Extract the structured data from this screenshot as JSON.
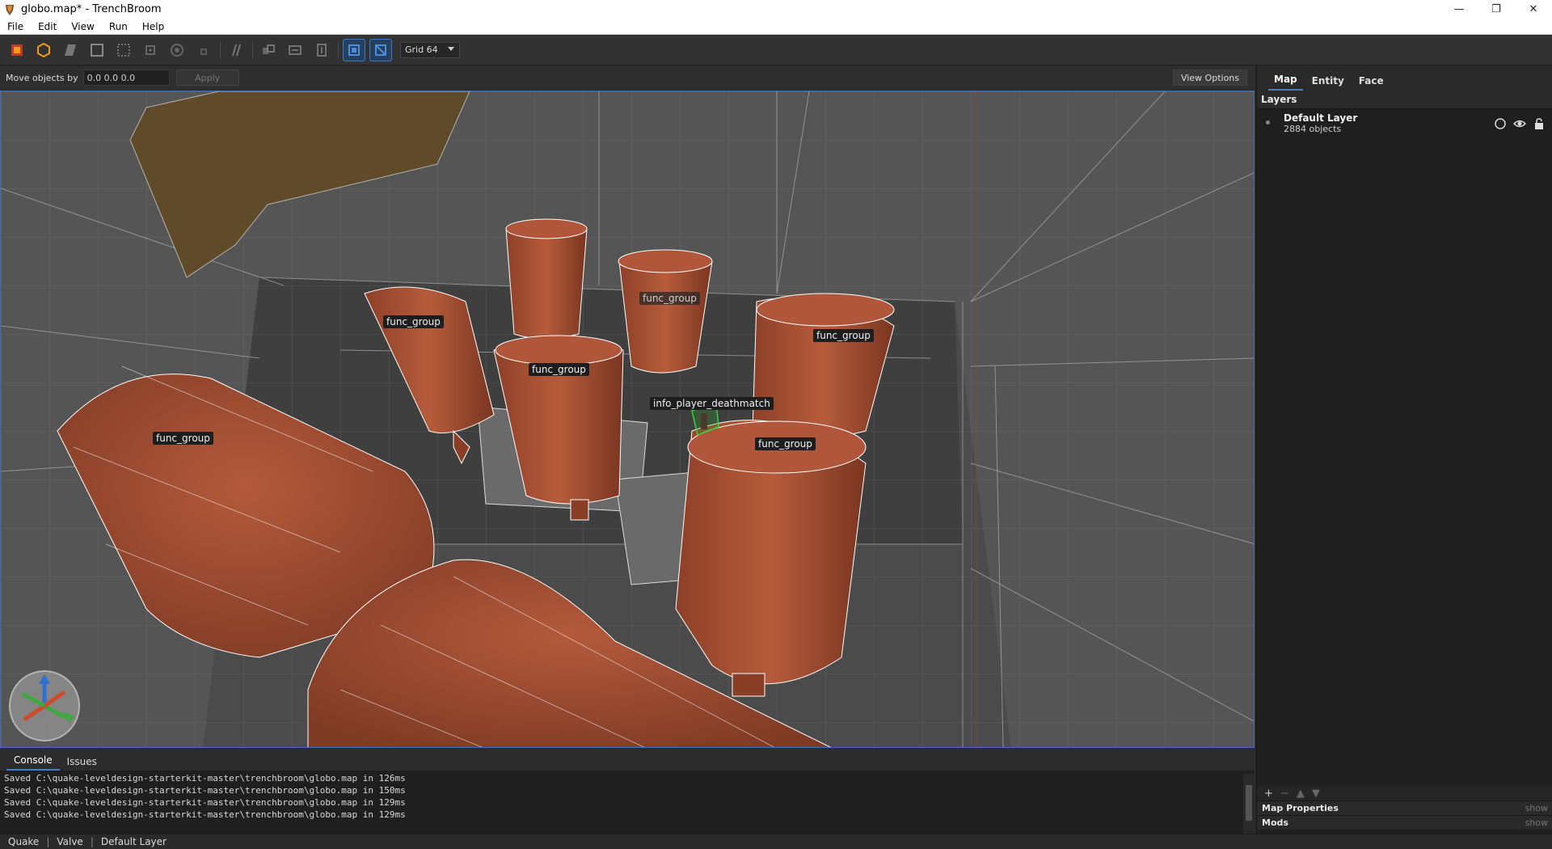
{
  "window": {
    "title": "globo.map* - TrenchBroom",
    "minimize": "—",
    "maximize": "❐",
    "close": "✕"
  },
  "menu": [
    "File",
    "Edit",
    "View",
    "Run",
    "Help"
  ],
  "toolbar": {
    "tools": [
      {
        "icon": "vertex-tool-icon",
        "active": false
      },
      {
        "icon": "edge-tool-icon",
        "active": false
      },
      {
        "icon": "face-tool-icon",
        "active": false
      },
      {
        "icon": "brush-tool-icon",
        "active": false
      },
      {
        "icon": "clip-tool-icon",
        "active": false
      },
      {
        "icon": "rotate-tool-icon",
        "active": false
      },
      {
        "icon": "scale-tool-icon",
        "active": false
      },
      {
        "icon": "shear-tool-icon",
        "active": false
      },
      {
        "icon": "duplicate-icon",
        "active": false
      },
      {
        "icon": "flip-horizontal-icon",
        "active": false
      },
      {
        "icon": "flip-vertical-icon",
        "active": false
      },
      {
        "icon": "texture-lock-icon",
        "active": true
      },
      {
        "icon": "uv-lock-icon",
        "active": true
      }
    ],
    "grid_value": "Grid 64"
  },
  "movebar": {
    "label": "Move objects by",
    "value": "0.0 0.0 0.0",
    "apply_label": "Apply",
    "view_options_label": "View Options"
  },
  "viewport": {
    "labels": {
      "group1": "func_group",
      "group2": "func_group",
      "group3": "func_group",
      "group4": "func_group",
      "group5": "func_group",
      "group6": "func_group",
      "player": "info_player_deathmatch"
    }
  },
  "console": {
    "tabs": [
      "Console",
      "Issues"
    ],
    "lines": [
      "Saved C:\\quake-leveldesign-starterkit-master\\trenchbroom\\globo.map in 126ms",
      "Saved C:\\quake-leveldesign-starterkit-master\\trenchbroom\\globo.map in 150ms",
      "Saved C:\\quake-leveldesign-starterkit-master\\trenchbroom\\globo.map in 129ms",
      "Saved C:\\quake-leveldesign-starterkit-master\\trenchbroom\\globo.map in 129ms"
    ]
  },
  "statusbar": {
    "game": "Quake",
    "format": "Valve",
    "layer": "Default Layer"
  },
  "rightpanel": {
    "tabs": [
      "Map",
      "Entity",
      "Face"
    ],
    "layers_title": "Layers",
    "layer_name": "Default Layer",
    "layer_count": "2884 objects",
    "map_properties": "Map Properties",
    "mods": "Mods",
    "show_label": "show"
  },
  "colors": {
    "accent": "#3f7fd0",
    "brush": "#9c4a30",
    "wire": "#ffffff",
    "grid_line": "#bdbdbd"
  }
}
